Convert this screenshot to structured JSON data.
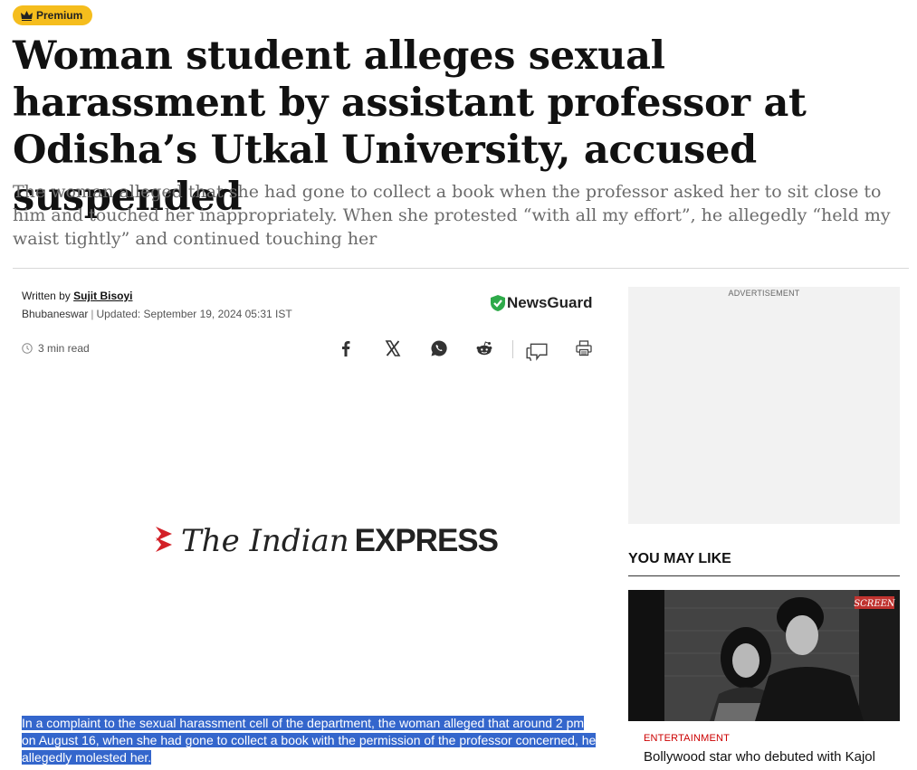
{
  "badge": {
    "label": "Premium"
  },
  "article": {
    "headline": "Woman student alleges sexual harassment by assistant professor at Odisha’s Utkal University, accused suspended",
    "subhead": "The woman alleged that she had gone to collect a book when the professor asked her to sit close to him and touched her inappropriately. When she protested “with all my effort”, he allegedly “held my waist tightly” and continued touching her",
    "byline_prefix": "Written by",
    "author": "Sujit Bisoyi",
    "location": "Bhubaneswar",
    "updated": "Updated: September 19, 2024 05:31 IST",
    "read_time": "3 min read",
    "newsguard": "NewsGuard",
    "logo_the": "The Indian",
    "logo_express": "EXPRESS",
    "caption": "In a complaint to the sexual harassment cell of the department, the woman alleged that around 2 pm on August 16, when she had gone to collect a book with the permission of the professor concerned, he allegedly molested her."
  },
  "share_icons": [
    "facebook-icon",
    "x-icon",
    "whatsapp-icon",
    "reddit-icon",
    "comment-icon",
    "print-icon"
  ],
  "sidebar": {
    "ad_label": "ADVERTISEMENT",
    "you_may_like": "YOU MAY LIKE",
    "card": {
      "tag": "SCREEN",
      "category": "ENTERTAINMENT",
      "title": "Bollywood star who debuted with Kajol"
    }
  },
  "colors": {
    "premium": "#f5bd1d",
    "newsguard_green": "#2eaa4a",
    "highlight": "#3466cc",
    "category": "#cc0000",
    "logo_red": "#d32027"
  }
}
